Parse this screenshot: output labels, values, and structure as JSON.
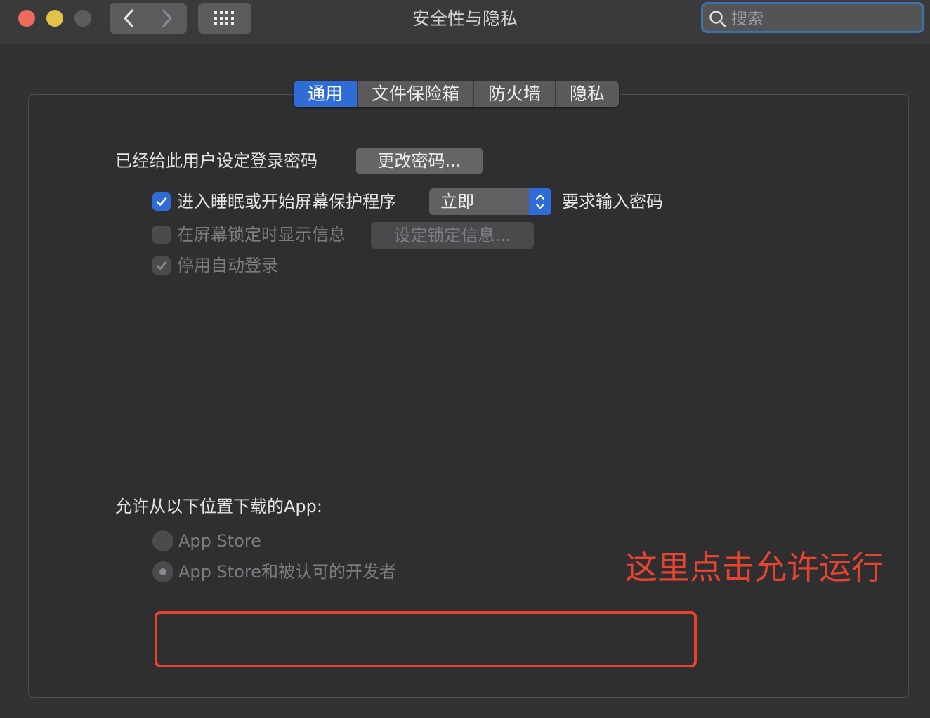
{
  "window": {
    "title": "安全性与隐私"
  },
  "search": {
    "placeholder": "搜索"
  },
  "tabs": [
    {
      "label": "通用",
      "active": true
    },
    {
      "label": "文件保险箱",
      "active": false
    },
    {
      "label": "防火墙",
      "active": false
    },
    {
      "label": "隐私",
      "active": false
    }
  ],
  "general": {
    "password_label": "已经给此用户设定登录密码",
    "change_password_button": "更改密码...",
    "sleep_option": {
      "label": "进入睡眠或开始屏幕保护程序",
      "checked": true,
      "delay_value": "立即",
      "suffix": "要求输入密码"
    },
    "lock_message": {
      "label": "在屏幕锁定时显示信息",
      "checked": false,
      "button": "设定锁定信息..."
    },
    "disable_auto_login": {
      "label": "停用自动登录",
      "checked": true
    }
  },
  "downloads": {
    "heading": "允许从以下位置下载的App:",
    "options": [
      {
        "label": "App Store",
        "selected": false
      },
      {
        "label": "App Store和被认可的开发者",
        "selected": true
      }
    ]
  },
  "annotation": {
    "text": "这里点击允许运行",
    "color": "#e8432f"
  },
  "colors": {
    "accent": "#2f6cd8",
    "close": "#ed6a5e",
    "minimize": "#e3c24b",
    "zoom_disabled": "#5c5c5e"
  }
}
